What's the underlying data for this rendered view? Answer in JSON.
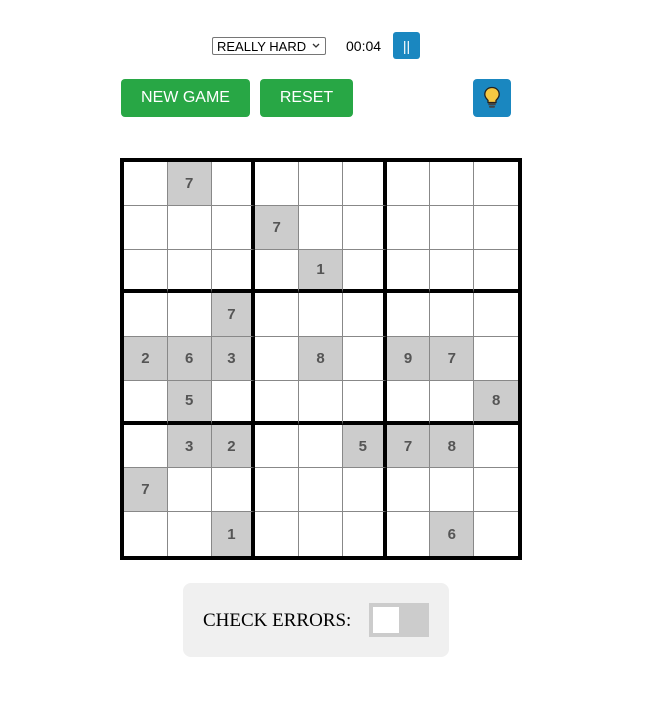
{
  "controls": {
    "difficulty": "REALLY HARD",
    "timer": "00:04",
    "pause_label": "||",
    "new_game_label": "NEW GAME",
    "reset_label": "RESET",
    "hint_icon": "lightbulb-icon"
  },
  "board": {
    "rows": [
      [
        "",
        "7",
        "",
        "",
        "",
        "",
        "",
        "",
        ""
      ],
      [
        "",
        "",
        "",
        "7",
        "",
        "",
        "",
        "",
        ""
      ],
      [
        "",
        "",
        "",
        "",
        "1",
        "",
        "",
        "",
        ""
      ],
      [
        "",
        "",
        "7",
        "",
        "",
        "",
        "",
        "",
        ""
      ],
      [
        "2",
        "6",
        "3",
        "",
        "8",
        "",
        "9",
        "7",
        ""
      ],
      [
        "",
        "5",
        "",
        "",
        "",
        "",
        "",
        "",
        "8"
      ],
      [
        "",
        "3",
        "2",
        "",
        "",
        "5",
        "7",
        "8",
        ""
      ],
      [
        "7",
        "",
        "",
        "",
        "",
        "",
        "",
        "",
        ""
      ],
      [
        "",
        "",
        "1",
        "",
        "",
        "",
        "",
        "6",
        ""
      ]
    ]
  },
  "check_errors": {
    "label": "CHECK ERRORS:",
    "enabled": false
  },
  "colors": {
    "accent_green": "#28a745",
    "accent_blue": "#1a87c0",
    "given_cell": "#cccccc",
    "toggle_off": "#cccccc",
    "panel_bg": "#f0f0f0"
  }
}
